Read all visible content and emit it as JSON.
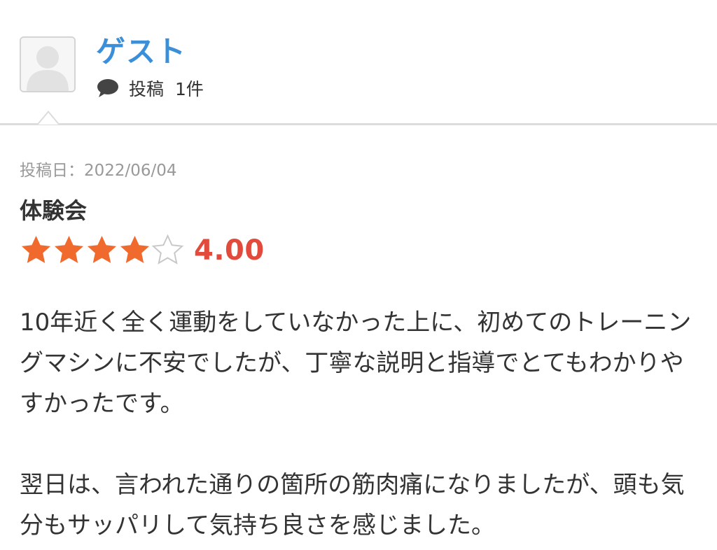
{
  "reviewer": {
    "name": "ゲスト",
    "post_label": "投稿",
    "post_count": "1件"
  },
  "review": {
    "date": "投稿日：2022/06/04",
    "title": "体験会",
    "rating": {
      "value": 4,
      "max": 5,
      "display": "4.00"
    },
    "paragraphs": [
      "10年近く全く運動をしていなかった上に、初めてのトレーニングマシンに不安でしたが、丁寧な説明と指導でとてもわかりやすかったです。",
      "翌日は、言われた通りの箇所の筋肉痛になりましたが、頭も気分もサッパリして気持ち良さを感じました。"
    ]
  },
  "icons": {
    "avatar": "default-user-icon",
    "comment": "speech-bubble-icon",
    "star_filled": "star-filled-icon",
    "star_empty": "star-empty-icon"
  },
  "colors": {
    "name_link": "#3b8fd9",
    "star_filled": "#f06a2e",
    "rating_value": "#e24a3b",
    "date_text": "#999999",
    "divider": "#dcdcdc"
  }
}
